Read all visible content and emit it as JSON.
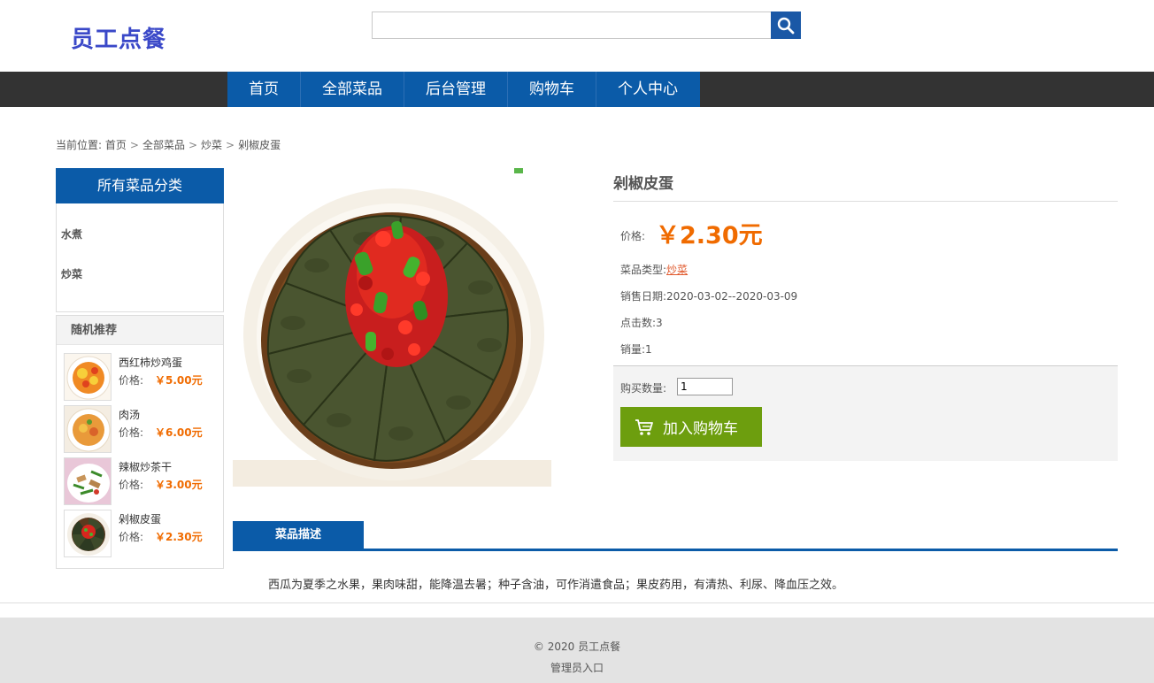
{
  "header": {
    "logo": "员工点餐",
    "search_placeholder": "",
    "search_value": ""
  },
  "nav": {
    "items": [
      "首页",
      "全部菜品",
      "后台管理",
      "购物车",
      "个人中心"
    ]
  },
  "breadcrumb": {
    "prefix": "当前位置:",
    "items": [
      "首页",
      "全部菜品",
      "炒菜",
      "剁椒皮蛋"
    ],
    "sep": ">"
  },
  "sidebar": {
    "category_title": "所有菜品分类",
    "categories": [
      "水煮",
      "炒菜"
    ],
    "recommend_title": "随机推荐",
    "recommend": [
      {
        "name": "西红柿炒鸡蛋",
        "price_label": "价格:",
        "price": "￥5.00元"
      },
      {
        "name": "肉汤",
        "price_label": "价格:",
        "price": "￥6.00元"
      },
      {
        "name": "辣椒炒茶干",
        "price_label": "价格:",
        "price": "￥3.00元"
      },
      {
        "name": "剁椒皮蛋",
        "price_label": "价格:",
        "price": "￥2.30元"
      }
    ]
  },
  "product": {
    "title": "剁椒皮蛋",
    "price_label": "价格:",
    "price": "￥2.30元",
    "type_label": "菜品类型:",
    "type_value": "炒菜",
    "date_label": "销售日期:",
    "date_value": "2020-03-02--2020-03-09",
    "clicks_label": "点击数:",
    "clicks_value": "3",
    "sales_label": "销量:",
    "sales_value": "1",
    "qty_label": "购买数量:",
    "qty_value": "1",
    "cart_button": "加入购物车"
  },
  "description": {
    "tab": "菜品描述",
    "text": "西瓜为夏季之水果，果肉味甜，能降温去暑；种子含油，可作消遣食品；果皮药用，有清热、利尿、降血压之效。"
  },
  "footer": {
    "copyright": "© 2020 员工点餐",
    "admin_link": "管理员入口"
  },
  "colors": {
    "brand_blue": "#0b5ba8",
    "nav_dark": "#333333",
    "price_orange": "#f06b00",
    "cart_green": "#6d9e0e",
    "logo": "#3a48c8"
  }
}
